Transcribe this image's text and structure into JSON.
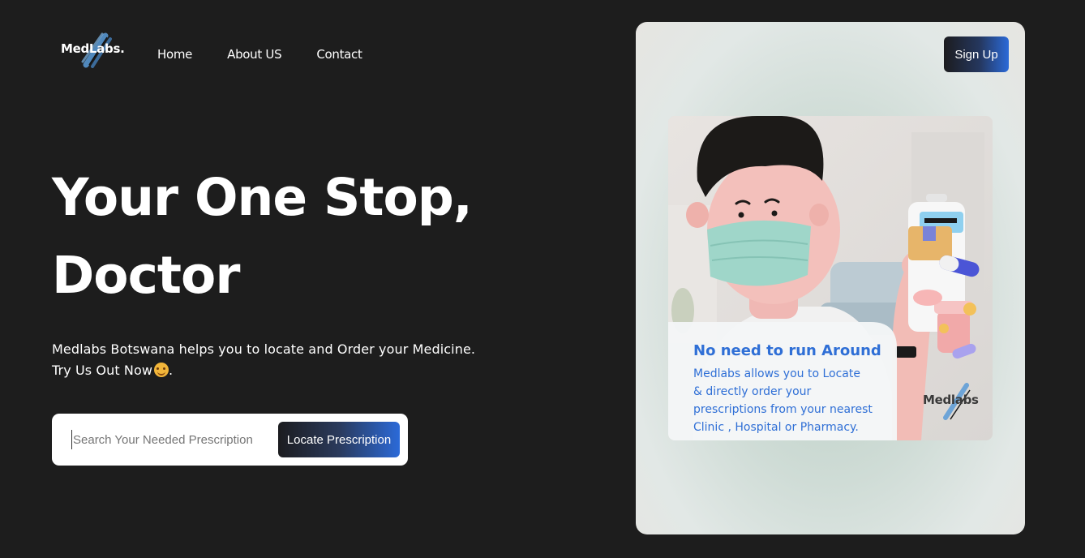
{
  "brand": {
    "logo_text": "MedLabs."
  },
  "nav": {
    "items": [
      {
        "label": "Home"
      },
      {
        "label": "About US"
      },
      {
        "label": "Contact"
      }
    ]
  },
  "hero": {
    "title_line1": "Your One Stop,",
    "title_line2": "Doctor",
    "subtitle_line1": "Medlabs Botswana helps you to locate and Order your Medicine.",
    "subtitle_line2": "Try Us Out Now",
    "subtitle_end": "."
  },
  "search": {
    "placeholder": "Search Your Needed Prescription",
    "button_label": "Locate Prescription"
  },
  "card": {
    "signup_label": "Sign Up",
    "illustration": {
      "title": "No need to run Around",
      "desc_line1": "Medlabs allows you to Locate",
      "desc_line2": "& directly order your",
      "desc_line3": "prescriptions from your nearest",
      "desc_line4": "Clinic , Hospital or Pharmacy.",
      "logo_text": "Medlabs"
    }
  },
  "colors": {
    "background": "#1d1d1d",
    "accent_blue": "#2b6ad8",
    "illustration_text": "#2f6fd6"
  }
}
